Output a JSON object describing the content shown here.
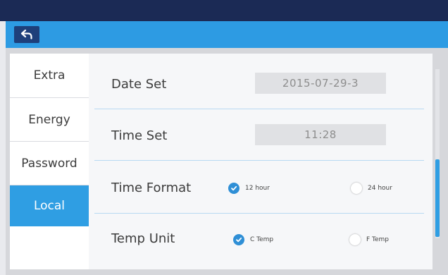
{
  "header": {
    "back_icon": "back-arrow-icon"
  },
  "sidebar": {
    "items": [
      {
        "label": "Extra",
        "active": false
      },
      {
        "label": "Energy",
        "active": false
      },
      {
        "label": "Password",
        "active": false
      },
      {
        "label": "Local",
        "active": true
      }
    ]
  },
  "settings": {
    "date_set": {
      "label": "Date Set",
      "value": "2015-07-29-3"
    },
    "time_set": {
      "label": "Time Set",
      "value": "11:28"
    },
    "time_format": {
      "label": "Time Format",
      "options": [
        {
          "label": "12 hour",
          "checked": true
        },
        {
          "label": "24 hour",
          "checked": false
        }
      ]
    },
    "temp_unit": {
      "label": "Temp Unit",
      "options": [
        {
          "label": "C Temp",
          "checked": true
        },
        {
          "label": "F Temp",
          "checked": false
        }
      ]
    }
  },
  "colors": {
    "accent": "#2f9ee3",
    "header_dark": "#1b2a55",
    "back_button": "#1e3f7a"
  }
}
